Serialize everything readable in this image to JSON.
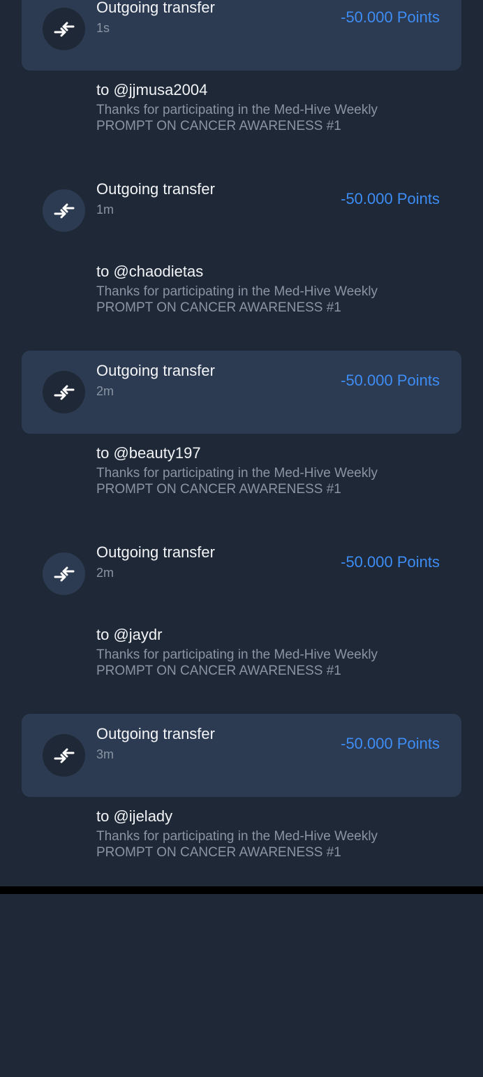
{
  "transactions": [
    {
      "title": "Outgoing transfer",
      "time": "1s",
      "amount": "-50.000 Points",
      "recipient": "to @jjmusa2004",
      "memo": "Thanks for participating in the Med-Hive Weekly PROMPT ON CANCER AWARENESS #1",
      "icon": "transfer-arrows-icon"
    },
    {
      "title": "Outgoing transfer",
      "time": "1m",
      "amount": "-50.000 Points",
      "recipient": "to @chaodietas",
      "memo": "Thanks for participating in the Med-Hive Weekly PROMPT ON CANCER AWARENESS #1",
      "icon": "transfer-arrows-icon"
    },
    {
      "title": "Outgoing transfer",
      "time": "2m",
      "amount": "-50.000 Points",
      "recipient": "to @beauty197",
      "memo": "Thanks for participating in the Med-Hive Weekly PROMPT ON CANCER AWARENESS #1",
      "icon": "transfer-arrows-icon"
    },
    {
      "title": "Outgoing transfer",
      "time": "2m",
      "amount": "-50.000 Points",
      "recipient": "to @jaydr",
      "memo": "Thanks for participating in the Med-Hive Weekly PROMPT ON CANCER AWARENESS #1",
      "icon": "transfer-arrows-icon"
    },
    {
      "title": "Outgoing transfer",
      "time": "3m",
      "amount": "-50.000 Points",
      "recipient": "to @ijelady",
      "memo": "Thanks for participating in the Med-Hive Weekly PROMPT ON CANCER AWARENESS #1",
      "icon": "transfer-arrows-icon"
    }
  ],
  "colors": {
    "background": "#1e2836",
    "card": "#2d3b52",
    "amount": "#3d8df5",
    "primary_text": "#f2f4f7",
    "secondary_text": "#8a94a3"
  }
}
